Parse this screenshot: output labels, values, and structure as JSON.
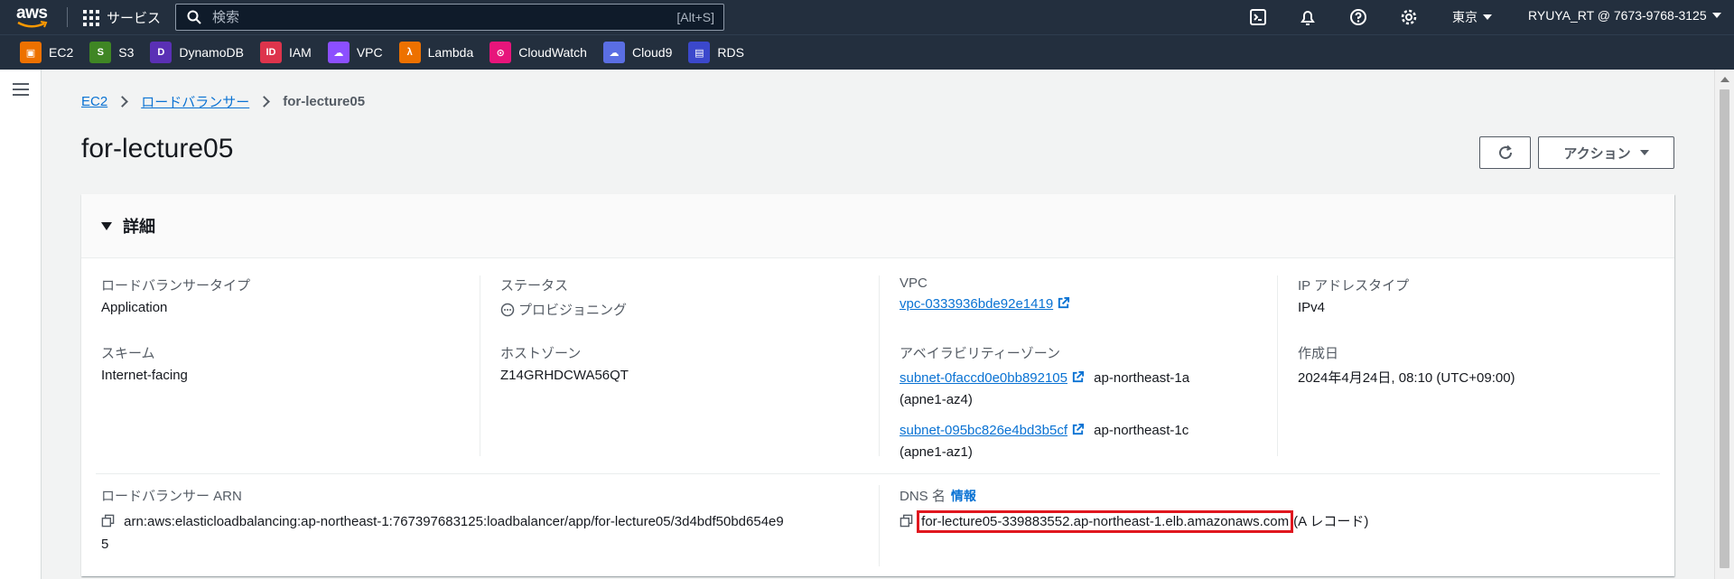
{
  "topnav": {
    "logo_text": "aws",
    "services_label": "サービス",
    "search_placeholder": "検索",
    "search_shortcut": "[Alt+S]",
    "region_label": "東京",
    "account_label": "RYUYA_RT @ 7673-9768-3125",
    "icons": [
      "cloudshell-icon",
      "notifications-icon",
      "help-icon",
      "settings-icon"
    ]
  },
  "favorites": [
    {
      "label": "EC2",
      "color": "#ed7100",
      "icon": "ec2-icon"
    },
    {
      "label": "S3",
      "color": "#3f8624",
      "icon": "s3-icon"
    },
    {
      "label": "DynamoDB",
      "color": "#5a30b5",
      "icon": "dynamodb-icon"
    },
    {
      "label": "IAM",
      "color": "#dd344c",
      "icon": "iam-icon"
    },
    {
      "label": "VPC",
      "color": "#8c4fff",
      "icon": "vpc-icon"
    },
    {
      "label": "Lambda",
      "color": "#ed7100",
      "icon": "lambda-icon"
    },
    {
      "label": "CloudWatch",
      "color": "#e7157b",
      "icon": "cloudwatch-icon"
    },
    {
      "label": "Cloud9",
      "color": "#5a6ee3",
      "icon": "cloud9-icon"
    },
    {
      "label": "RDS",
      "color": "#3b48cc",
      "icon": "rds-icon"
    }
  ],
  "breadcrumb": {
    "items": [
      "EC2",
      "ロードバランサー"
    ],
    "current": "for-lecture05"
  },
  "page": {
    "title": "for-lecture05",
    "actions_label": "アクション"
  },
  "details": {
    "heading": "詳細",
    "lb_type_label": "ロードバランサータイプ",
    "lb_type_value": "Application",
    "scheme_label": "スキーム",
    "scheme_value": "Internet-facing",
    "status_label": "ステータス",
    "status_value": "プロビジョニング",
    "hosted_zone_label": "ホストゾーン",
    "hosted_zone_value": "Z14GRHDCWA56QT",
    "vpc_label": "VPC",
    "vpc_value": "vpc-0333936bde92e1419",
    "az_label": "アベイラビリティーゾーン",
    "az": [
      {
        "subnet": "subnet-0faccd0e0bb892105",
        "zone": "ap-northeast-1a",
        "zone_id": "(apne1-az4)"
      },
      {
        "subnet": "subnet-095bc826e4bd3b5cf",
        "zone": "ap-northeast-1c",
        "zone_id": "(apne1-az1)"
      }
    ],
    "ip_type_label": "IP アドレスタイプ",
    "ip_type_value": "IPv4",
    "created_label": "作成日",
    "created_value": "2024年4月24日, 08:10 (UTC+09:00)",
    "arn_label": "ロードバランサー ARN",
    "arn_value_line1": "arn:aws:elasticloadbalancing:ap-northeast-1:767397683125:loadbalancer/app/for-lecture05/3d4bdf50bd654e9",
    "arn_value_line2": "5",
    "dns_label": "DNS 名",
    "dns_info": "情報",
    "dns_value": "for-lecture05-339883552.ap-northeast-1.elb.amazonaws.com",
    "dns_suffix": "(A レコード)"
  }
}
